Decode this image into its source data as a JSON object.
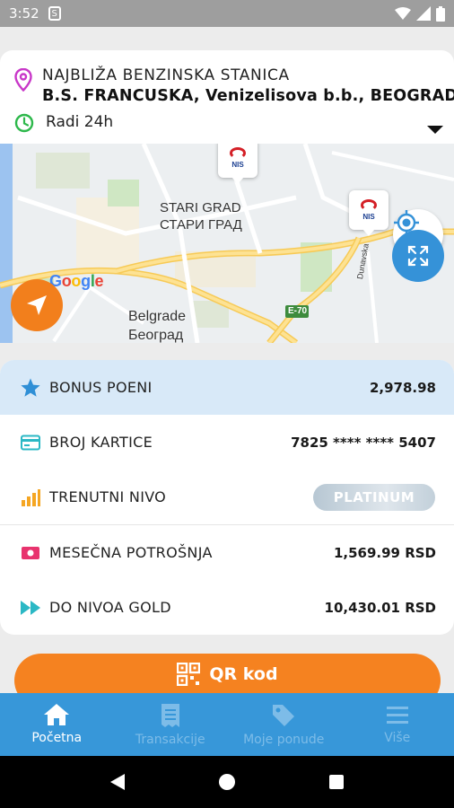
{
  "status_bar": {
    "time": "3:52",
    "sim_icon": "sim-card-icon",
    "icons": [
      "wifi-icon",
      "signal-icon",
      "battery-icon"
    ]
  },
  "station": {
    "label": "NAJBLIŽA BENZINSKA STANICA",
    "address": "B.S. FRANCUSKA, Venizelisova b.b., BEOGRAD",
    "hours": "Radi 24h"
  },
  "map": {
    "district_latin": "STARI GRAD",
    "district_cyrillic": "СТАРИ ГРАД",
    "city_latin": "Belgrade",
    "city_cyrillic": "Београд",
    "road_shield": "E-70",
    "street": "Dunavska",
    "provider": "Google",
    "marker_label": "NIS"
  },
  "loyalty": {
    "bonus_label": "BONUS POENI",
    "bonus_value": "2,978.98",
    "card_label": "BROJ KARTICE",
    "card_value": "7825 **** **** 5407",
    "level_label": "TRENUTNI NIVO",
    "level_value": "PLATINUM",
    "monthly_label": "MESEČNA POTROŠNJA",
    "monthly_value": "1,569.99 RSD",
    "gold_label": "DO NIVOA GOLD",
    "gold_value": "10,430.01 RSD"
  },
  "qr_button": {
    "label": "QR kod"
  },
  "nav": {
    "home": "Početna",
    "transactions": "Transakcije",
    "offers": "Moje ponude",
    "more": "Više"
  },
  "colors": {
    "accent": "#f58220",
    "primary": "#3797d9",
    "highlight": "#d8e9f8"
  }
}
